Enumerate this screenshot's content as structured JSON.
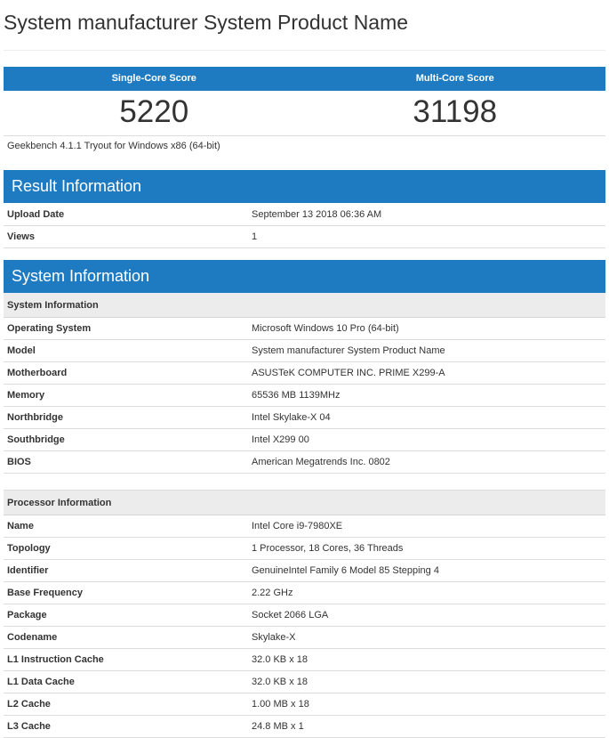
{
  "page_title": "System manufacturer System Product Name",
  "scores": {
    "single_label": "Single-Core Score",
    "multi_label": "Multi-Core Score",
    "single_value": "5220",
    "multi_value": "31198"
  },
  "benchmark_note": "Geekbench 4.1.1 Tryout for Windows x86 (64-bit)",
  "result_information": {
    "header": "Result Information",
    "rows": [
      {
        "label": "Upload Date",
        "value": "September 13 2018 06:36 AM"
      },
      {
        "label": "Views",
        "value": "1"
      }
    ]
  },
  "system_information": {
    "header": "System Information",
    "system_sub": {
      "title": "System Information",
      "rows": [
        {
          "label": "Operating System",
          "value": "Microsoft Windows 10 Pro (64-bit)"
        },
        {
          "label": "Model",
          "value": "System manufacturer System Product Name"
        },
        {
          "label": "Motherboard",
          "value": "ASUSTeK COMPUTER INC. PRIME X299-A"
        },
        {
          "label": "Memory",
          "value": "65536 MB 1139MHz"
        },
        {
          "label": "Northbridge",
          "value": "Intel Skylake-X 04"
        },
        {
          "label": "Southbridge",
          "value": "Intel X299 00"
        },
        {
          "label": "BIOS",
          "value": "American Megatrends Inc. 0802"
        }
      ]
    },
    "processor_sub": {
      "title": "Processor Information",
      "rows": [
        {
          "label": "Name",
          "value": "Intel Core i9-7980XE"
        },
        {
          "label": "Topology",
          "value": "1 Processor, 18 Cores, 36 Threads"
        },
        {
          "label": "Identifier",
          "value": "GenuineIntel Family 6 Model 85 Stepping 4"
        },
        {
          "label": "Base Frequency",
          "value": "2.22 GHz"
        },
        {
          "label": "Package",
          "value": "Socket 2066 LGA"
        },
        {
          "label": "Codename",
          "value": "Skylake-X"
        },
        {
          "label": "L1 Instruction Cache",
          "value": "32.0 KB x 18"
        },
        {
          "label": "L1 Data Cache",
          "value": "32.0 KB x 18"
        },
        {
          "label": "L2 Cache",
          "value": "1.00 MB x 18"
        },
        {
          "label": "L3 Cache",
          "value": "24.8 MB x 1"
        }
      ]
    }
  }
}
